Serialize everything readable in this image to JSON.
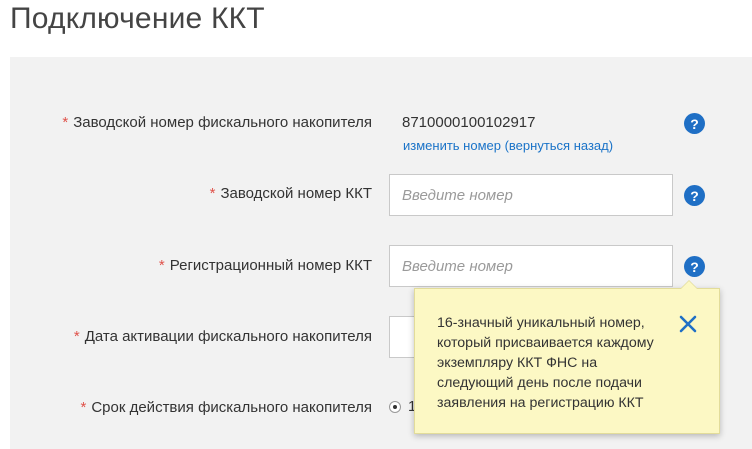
{
  "page": {
    "title": "Подключение ККТ"
  },
  "form": {
    "required_mark": "*",
    "fn_serial": {
      "label": "Заводской номер фискального накопителя",
      "value": "8710000100102917",
      "change_link": "изменить номер (вернуться назад)"
    },
    "kkt_serial": {
      "label": "Заводской номер ККТ",
      "placeholder": "Введите номер"
    },
    "kkt_reg": {
      "label": "Регистрационный номер ККТ",
      "placeholder": "Введите номер"
    },
    "fn_activation": {
      "label": "Дата активации фискального накопителя"
    },
    "fn_validity": {
      "label": "Срок действия фискального накопителя",
      "option_visible": "1"
    },
    "help_icon": "?"
  },
  "tooltip": {
    "text": "16-значный уникальный номер, который присваивается каждому экземпляру ККТ ФНС на следующий день после подачи заявления на регистрацию ККТ"
  },
  "colors": {
    "accent": "#1f6fc5",
    "required": "#e0524a",
    "tooltip_bg": "#fcf8c4",
    "panel_bg": "#f2f2f2"
  },
  "icons": [
    "help-icon",
    "close-icon",
    "radio-icon"
  ]
}
